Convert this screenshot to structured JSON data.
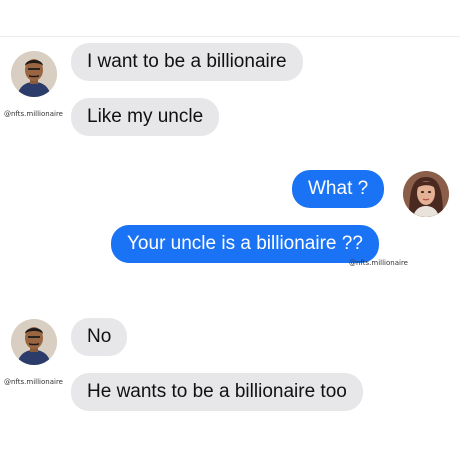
{
  "conversation": {
    "block1": {
      "watermark": "@nfts.millionaire",
      "messages": [
        "I want to be a billionaire",
        "Like my uncle"
      ]
    },
    "block2": {
      "watermark": "@nfts.millionaire",
      "messages": [
        "What ?",
        "Your uncle is a billionaire ??"
      ]
    },
    "block3": {
      "watermark": "@nfts.millionaire",
      "messages": [
        "No",
        "He wants to be a billionaire too"
      ]
    }
  },
  "colors": {
    "incoming_bubble": "#e7e7ea",
    "outgoing_bubble": "#1a73f5",
    "incoming_text": "#111111",
    "outgoing_text": "#ffffff"
  },
  "icons": {
    "man_avatar": "man-avatar-icon",
    "woman_avatar": "woman-avatar-icon"
  }
}
